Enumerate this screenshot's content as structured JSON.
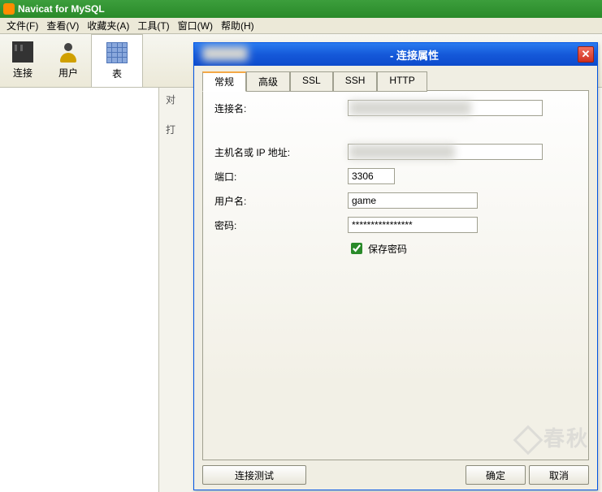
{
  "app": {
    "title": "Navicat for MySQL"
  },
  "menu": {
    "items": [
      "文件(F)",
      "查看(V)",
      "收藏夹(A)",
      "工具(T)",
      "窗口(W)",
      "帮助(H)"
    ]
  },
  "toolbar": {
    "items": [
      {
        "label": "连接",
        "icon": "connection"
      },
      {
        "label": "用户",
        "icon": "user"
      },
      {
        "label": "表",
        "icon": "table"
      }
    ]
  },
  "right_panel": {
    "row1": "对",
    "row2": "打"
  },
  "dialog": {
    "title": "- 连接属性",
    "tabs": [
      "常规",
      "高级",
      "SSL",
      "SSH",
      "HTTP"
    ],
    "active_tab": 0,
    "labels": {
      "connection_name": "连接名:",
      "host": "主机名或 IP 地址:",
      "port": "端口:",
      "username": "用户名:",
      "password": "密码:",
      "save_password": "保存密码"
    },
    "values": {
      "connection_name": "",
      "host": "",
      "port": "3306",
      "username": "game",
      "password": "****************",
      "save_password": true
    },
    "buttons": {
      "test": "连接测试",
      "ok": "确定",
      "cancel": "取消"
    }
  },
  "watermark": "春秋"
}
